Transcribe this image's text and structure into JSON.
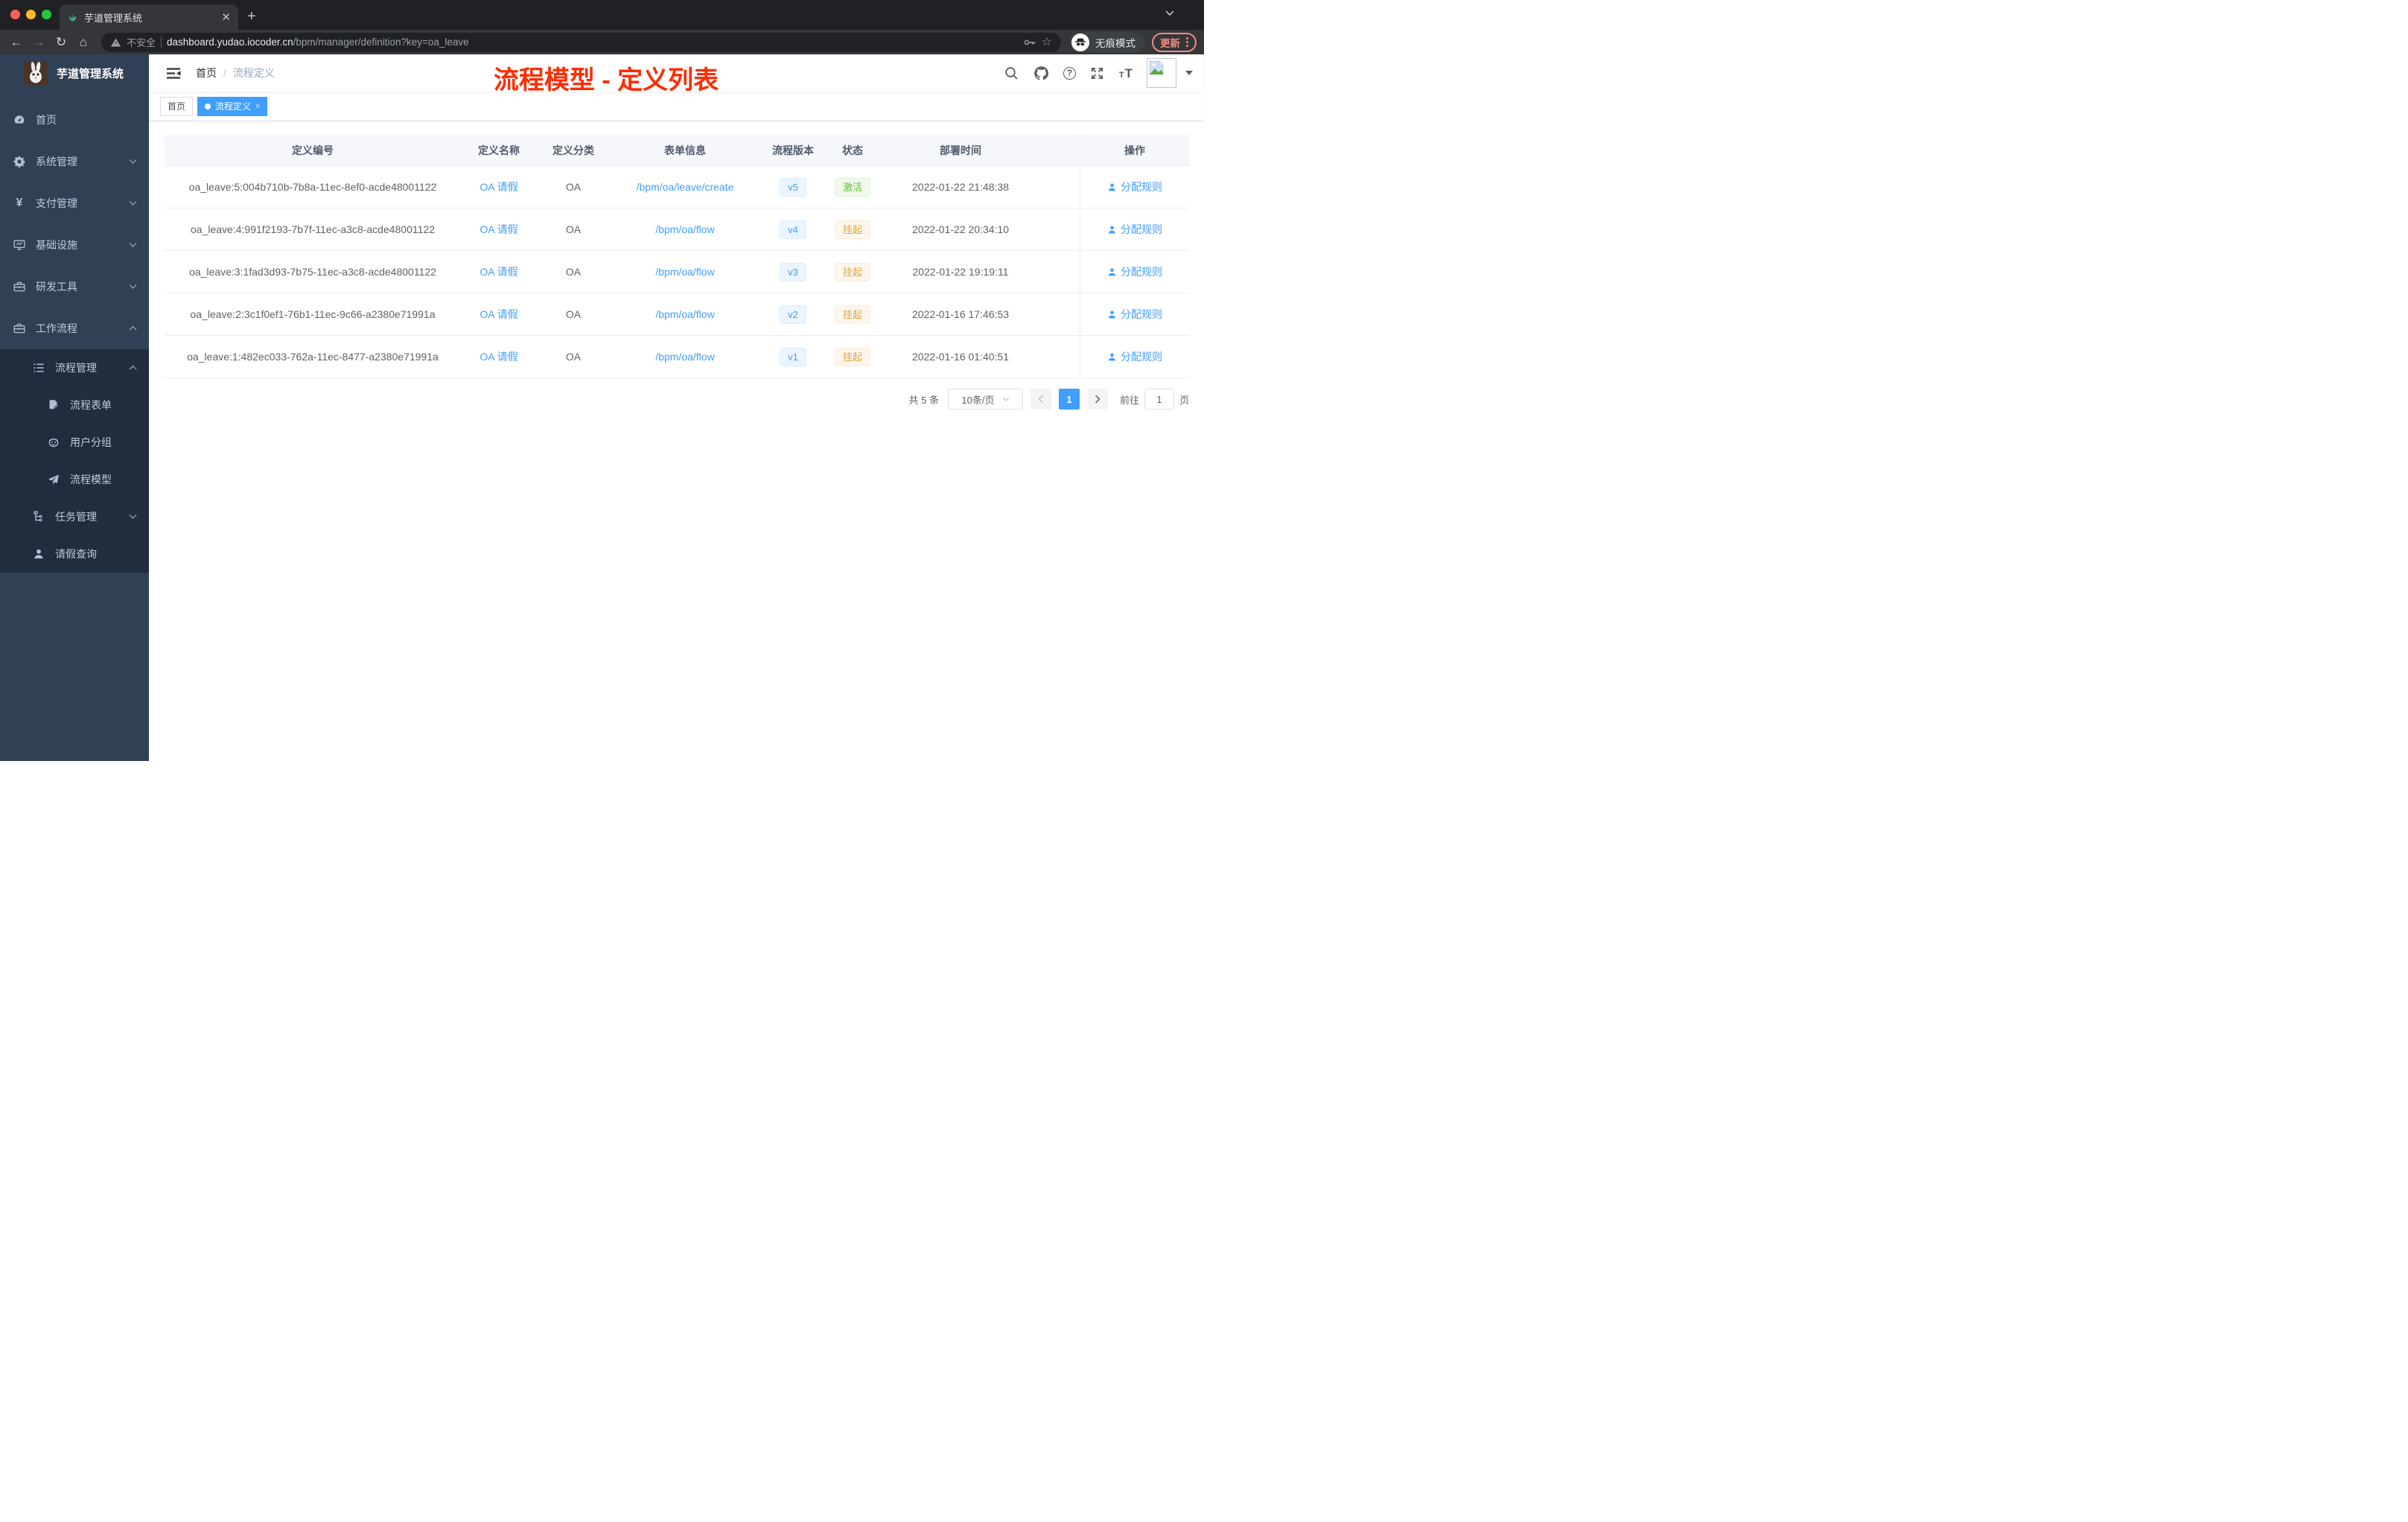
{
  "browser": {
    "tab": {
      "title": "芋道管理系统",
      "close": "✕",
      "new_tab": "+"
    },
    "address": {
      "warning_label": "不安全",
      "domain": "dashboard.yudao.iocoder.cn",
      "path": "/bpm/manager/definition?key=oa_leave"
    },
    "incognito_label": "无痕模式",
    "update_label": "更新"
  },
  "sidebar": {
    "logo_title": "芋道管理系统",
    "menu": [
      {
        "label": "首页",
        "icon": "dashboard-icon"
      },
      {
        "label": "系统管理",
        "icon": "gear-icon",
        "expand": "down"
      },
      {
        "label": "支付管理",
        "icon": "yen-icon",
        "expand": "down"
      },
      {
        "label": "基础设施",
        "icon": "monitor-icon",
        "expand": "down"
      },
      {
        "label": "研发工具",
        "icon": "toolbox-icon",
        "expand": "down"
      },
      {
        "label": "工作流程",
        "icon": "briefcase-icon",
        "expand": "up"
      },
      {
        "label": "流程管理",
        "icon": "list-tree-icon",
        "expand": "up"
      },
      {
        "label": "流程表单",
        "icon": "form-icon"
      },
      {
        "label": "用户分组",
        "icon": "robot-icon"
      },
      {
        "label": "流程模型",
        "icon": "paper-plane-icon"
      },
      {
        "label": "任务管理",
        "icon": "tree-icon",
        "expand": "down"
      },
      {
        "label": "请假查询",
        "icon": "user-icon"
      }
    ]
  },
  "navbar": {
    "breadcrumb": {
      "home": "首页",
      "separator": "/",
      "current": "流程定义"
    },
    "annotation": "流程模型 - 定义列表"
  },
  "tags": [
    {
      "label": "首页",
      "active": false
    },
    {
      "label": "流程定义",
      "active": true,
      "close": "×"
    }
  ],
  "table": {
    "columns": {
      "id": "定义编号",
      "name": "定义名称",
      "category": "定义分类",
      "form": "表单信息",
      "version": "流程版本",
      "status": "状态",
      "deploy_time": "部署时间",
      "action": "操作"
    },
    "rows": [
      {
        "id": "oa_leave:5:004b710b-7b8a-11ec-8ef0-acde48001122",
        "name": "OA 请假",
        "category": "OA",
        "form": "/bpm/oa/leave/create",
        "version": "v5",
        "status": "激活",
        "status_type": "success",
        "deploy_time": "2022-01-22 21:48:38",
        "action": "分配规则"
      },
      {
        "id": "oa_leave:4:991f2193-7b7f-11ec-a3c8-acde48001122",
        "name": "OA 请假",
        "category": "OA",
        "form": "/bpm/oa/flow",
        "version": "v4",
        "status": "挂起",
        "status_type": "warning",
        "deploy_time": "2022-01-22 20:34:10",
        "action": "分配规则"
      },
      {
        "id": "oa_leave:3:1fad3d93-7b75-11ec-a3c8-acde48001122",
        "name": "OA 请假",
        "category": "OA",
        "form": "/bpm/oa/flow",
        "version": "v3",
        "status": "挂起",
        "status_type": "warning",
        "deploy_time": "2022-01-22 19:19:11",
        "action": "分配规则"
      },
      {
        "id": "oa_leave:2:3c1f0ef1-76b1-11ec-9c66-a2380e71991a",
        "name": "OA 请假",
        "category": "OA",
        "form": "/bpm/oa/flow",
        "version": "v2",
        "status": "挂起",
        "status_type": "warning",
        "deploy_time": "2022-01-16 17:46:53",
        "action": "分配规则"
      },
      {
        "id": "oa_leave:1:482ec033-762a-11ec-8477-a2380e71991a",
        "name": "OA 请假",
        "category": "OA",
        "form": "/bpm/oa/flow",
        "version": "v1",
        "status": "挂起",
        "status_type": "warning",
        "deploy_time": "2022-01-16 01:40:51",
        "action": "分配规则"
      }
    ]
  },
  "pagination": {
    "total": "共 5 条",
    "page_size": "10条/页",
    "current_page": "1",
    "goto_label": "前往",
    "goto_value": "1",
    "page_unit": "页"
  },
  "colors": {
    "accent": "#409eff",
    "success": "#67c23a",
    "warning": "#e6a23c",
    "annotation_red": "#fe2c00",
    "sidebar_bg": "#304156",
    "sidebar_submenu_bg": "#1f2d3d",
    "status_ok_bg": "#f0f9eb",
    "status_suspend_bg": "#fdf6ec",
    "version_bg": "#ecf5ff"
  }
}
